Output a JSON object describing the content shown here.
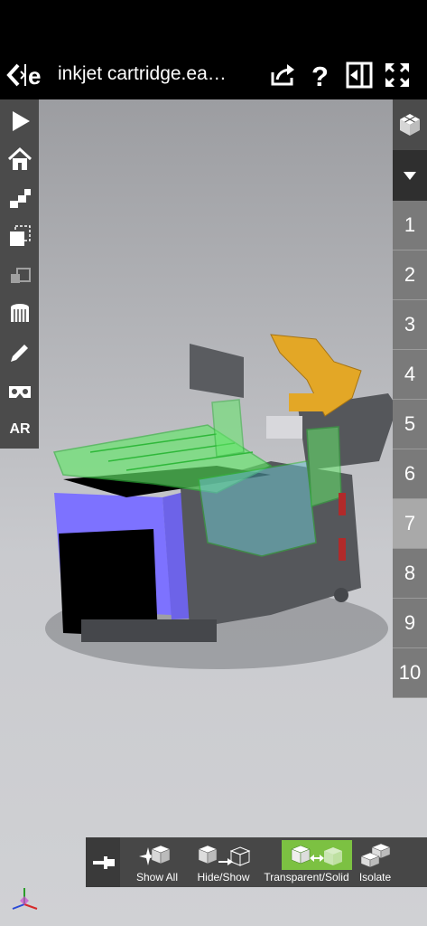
{
  "header": {
    "title": "inkjet cartridge.ea…",
    "back_icon": "back-logo-icon",
    "actions": [
      "share-icon",
      "help-icon",
      "exit-icon",
      "fullscreen-icon"
    ]
  },
  "left_toolbar": {
    "items": [
      "play-icon",
      "home-icon",
      "steps-icon",
      "bounding-box-icon",
      "clone-icon",
      "section-icon",
      "markup-pen-icon",
      "vr-headset-icon"
    ],
    "ar_label": "AR"
  },
  "right_toolbar": {
    "cube_icon": "view-cube-icon",
    "dropdown_icon": "chevron-down-icon",
    "steps": [
      "1",
      "2",
      "3",
      "4",
      "5",
      "6",
      "7",
      "8",
      "9",
      "10"
    ],
    "active_step": "7"
  },
  "bottom_bar": {
    "pin_icon": "pin-icon",
    "show_all": "Show All",
    "hide_show": "Hide/Show",
    "transparent_solid": "Transparent/Solid",
    "isolate": "Isolate",
    "active_item": "Transparent/Solid"
  },
  "colors": {
    "accent_active": "#7cc142",
    "cartridge_body": "#7d72ff",
    "frame": "#55575b",
    "highlight": "#64e86a",
    "latch": "#e3a726"
  }
}
